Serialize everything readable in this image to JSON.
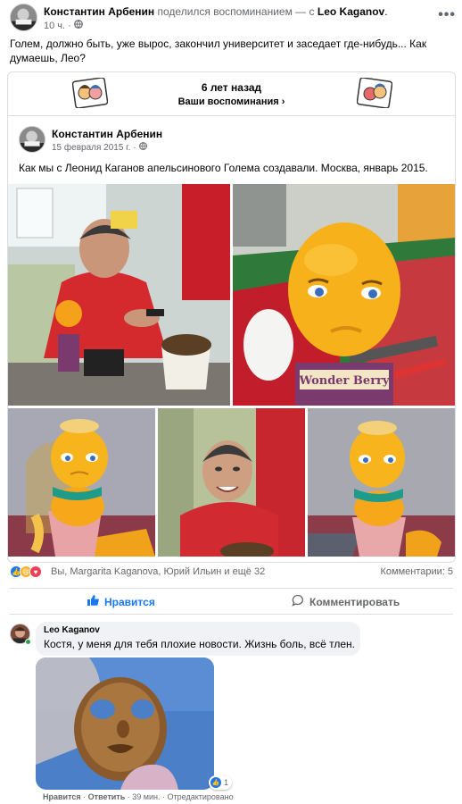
{
  "post": {
    "author": "Константин Арбенин",
    "shared_text": "поделился воспоминанием — с",
    "tagged": "Leo Kaganov",
    "dot": ".",
    "time": "10 ч.",
    "separator": "·",
    "more": "•••",
    "text": "Голем, должно быть, уже вырос, закончил университет и заседает где-нибудь... Как думаешь, Лео?"
  },
  "memory": {
    "years_ago": "6 лет назад",
    "link": "Ваши воспоминания",
    "chevron": "›"
  },
  "original_post": {
    "author": "Константин Арбенин",
    "date": "15 февраля 2015 г.",
    "separator": "·",
    "text": "Как мы с Леонид Каганов апельсинового Голема создавали. Москва, январь 2015.",
    "box_label": "Wonder Berry"
  },
  "reactions": {
    "icons": [
      "like",
      "haha",
      "love"
    ],
    "icon_colors": {
      "like": "#1877f2",
      "haha": "#f7b125",
      "love": "#f33e58"
    },
    "reactors": "Вы, Margarita Kaganova, Юрий Ильин и ещё 32",
    "comments": "Комментарии: 5"
  },
  "actions": {
    "like": "Нравится",
    "comment": "Комментировать"
  },
  "comment": {
    "author": "Leo Kaganov",
    "text": "Костя, у меня для тебя плохие новости. Жизнь боль, всё тлен.",
    "reaction_count": "1",
    "like": "Нравится",
    "reply": "Ответить",
    "time": "39 мин.",
    "edited": "Отредактировано",
    "sep": "·"
  }
}
